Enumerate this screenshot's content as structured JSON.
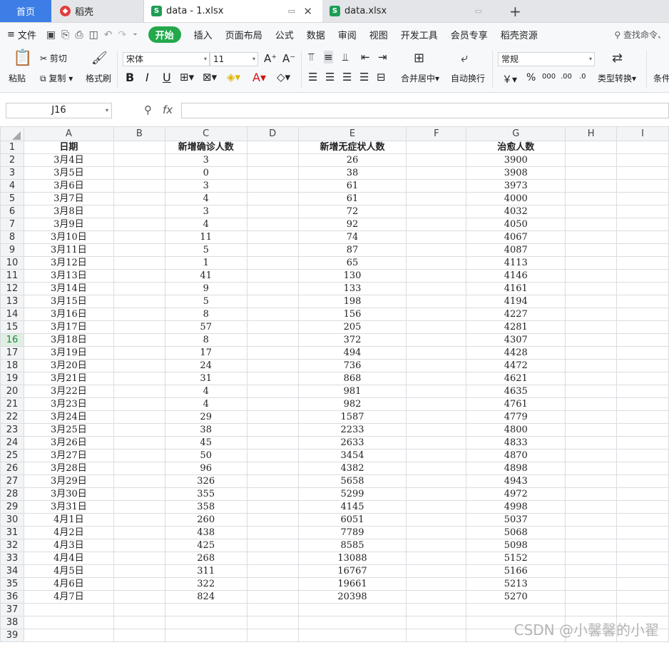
{
  "tabs": {
    "home": "首页",
    "daoke": "稻壳",
    "active_file": "data - 1.xlsx",
    "other_file": "data.xlsx",
    "add": "+"
  },
  "menu": {
    "file": "文件",
    "items": [
      "开始",
      "插入",
      "页面布局",
      "公式",
      "数据",
      "审阅",
      "视图",
      "开发工具",
      "会员专享",
      "稻壳资源"
    ],
    "search": "查找命令、"
  },
  "ribbon": {
    "paste": "粘贴",
    "cut": "剪切",
    "copy": "复制",
    "format_painter": "格式刷",
    "font_name": "宋体",
    "font_size": "11",
    "merge_center": "合并居中",
    "wrap_text": "自动换行",
    "number_format": "常规",
    "type_convert": "类型转换",
    "conditional": "条件",
    "currency": "￥",
    "percent": "%",
    "thousands": "000",
    "inc_decimal": ".00",
    "dec_decimal": ".0"
  },
  "formula_bar": {
    "cell_ref": "J16",
    "fx": "fx",
    "value": ""
  },
  "sheet": {
    "columns": [
      "A",
      "B",
      "C",
      "D",
      "E",
      "F",
      "G",
      "H",
      "I"
    ],
    "header_row": [
      "日期",
      "",
      "新增确诊人数",
      "",
      "新增无症状人数",
      "",
      "治愈人数",
      "",
      ""
    ],
    "rows": [
      [
        "3月4日",
        "",
        "3",
        "",
        "26",
        "",
        "3900"
      ],
      [
        "3月5日",
        "",
        "0",
        "",
        "38",
        "",
        "3908"
      ],
      [
        "3月6日",
        "",
        "3",
        "",
        "61",
        "",
        "3973"
      ],
      [
        "3月7日",
        "",
        "4",
        "",
        "61",
        "",
        "4000"
      ],
      [
        "3月8日",
        "",
        "3",
        "",
        "72",
        "",
        "4032"
      ],
      [
        "3月9日",
        "",
        "4",
        "",
        "92",
        "",
        "4050"
      ],
      [
        "3月10日",
        "",
        "11",
        "",
        "74",
        "",
        "4067"
      ],
      [
        "3月11日",
        "",
        "5",
        "",
        "87",
        "",
        "4087"
      ],
      [
        "3月12日",
        "",
        "1",
        "",
        "65",
        "",
        "4113"
      ],
      [
        "3月13日",
        "",
        "41",
        "",
        "130",
        "",
        "4146"
      ],
      [
        "3月14日",
        "",
        "9",
        "",
        "133",
        "",
        "4161"
      ],
      [
        "3月15日",
        "",
        "5",
        "",
        "198",
        "",
        "4194"
      ],
      [
        "3月16日",
        "",
        "8",
        "",
        "156",
        "",
        "4227"
      ],
      [
        "3月17日",
        "",
        "57",
        "",
        "205",
        "",
        "4281"
      ],
      [
        "3月18日",
        "",
        "8",
        "",
        "372",
        "",
        "4307"
      ],
      [
        "3月19日",
        "",
        "17",
        "",
        "494",
        "",
        "4428"
      ],
      [
        "3月20日",
        "",
        "24",
        "",
        "736",
        "",
        "4472"
      ],
      [
        "3月21日",
        "",
        "31",
        "",
        "868",
        "",
        "4621"
      ],
      [
        "3月22日",
        "",
        "4",
        "",
        "981",
        "",
        "4635"
      ],
      [
        "3月23日",
        "",
        "4",
        "",
        "982",
        "",
        "4761"
      ],
      [
        "3月24日",
        "",
        "29",
        "",
        "1587",
        "",
        "4779"
      ],
      [
        "3月25日",
        "",
        "38",
        "",
        "2233",
        "",
        "4800"
      ],
      [
        "3月26日",
        "",
        "45",
        "",
        "2633",
        "",
        "4833"
      ],
      [
        "3月27日",
        "",
        "50",
        "",
        "3454",
        "",
        "4870"
      ],
      [
        "3月28日",
        "",
        "96",
        "",
        "4382",
        "",
        "4898"
      ],
      [
        "3月29日",
        "",
        "326",
        "",
        "5658",
        "",
        "4943"
      ],
      [
        "3月30日",
        "",
        "355",
        "",
        "5299",
        "",
        "4972"
      ],
      [
        "3月31日",
        "",
        "358",
        "",
        "4145",
        "",
        "4998"
      ],
      [
        "4月1日",
        "",
        "260",
        "",
        "6051",
        "",
        "5037"
      ],
      [
        "4月2日",
        "",
        "438",
        "",
        "7789",
        "",
        "5068"
      ],
      [
        "4月3日",
        "",
        "425",
        "",
        "8585",
        "",
        "5098"
      ],
      [
        "4月4日",
        "",
        "268",
        "",
        "13088",
        "",
        "5152"
      ],
      [
        "4月5日",
        "",
        "311",
        "",
        "16767",
        "",
        "5166"
      ],
      [
        "4月6日",
        "",
        "322",
        "",
        "19661",
        "",
        "5213"
      ],
      [
        "4月7日",
        "",
        "824",
        "",
        "20398",
        "",
        "5270"
      ]
    ],
    "empty_row_numbers": [
      37,
      38,
      39
    ],
    "active_row": 16
  },
  "watermark": "CSDN @小馨馨的小翟",
  "colors": {
    "home_tab": "#3d7ee6",
    "start_button": "#23a84c",
    "sheet_icon": "#1f9d55"
  }
}
